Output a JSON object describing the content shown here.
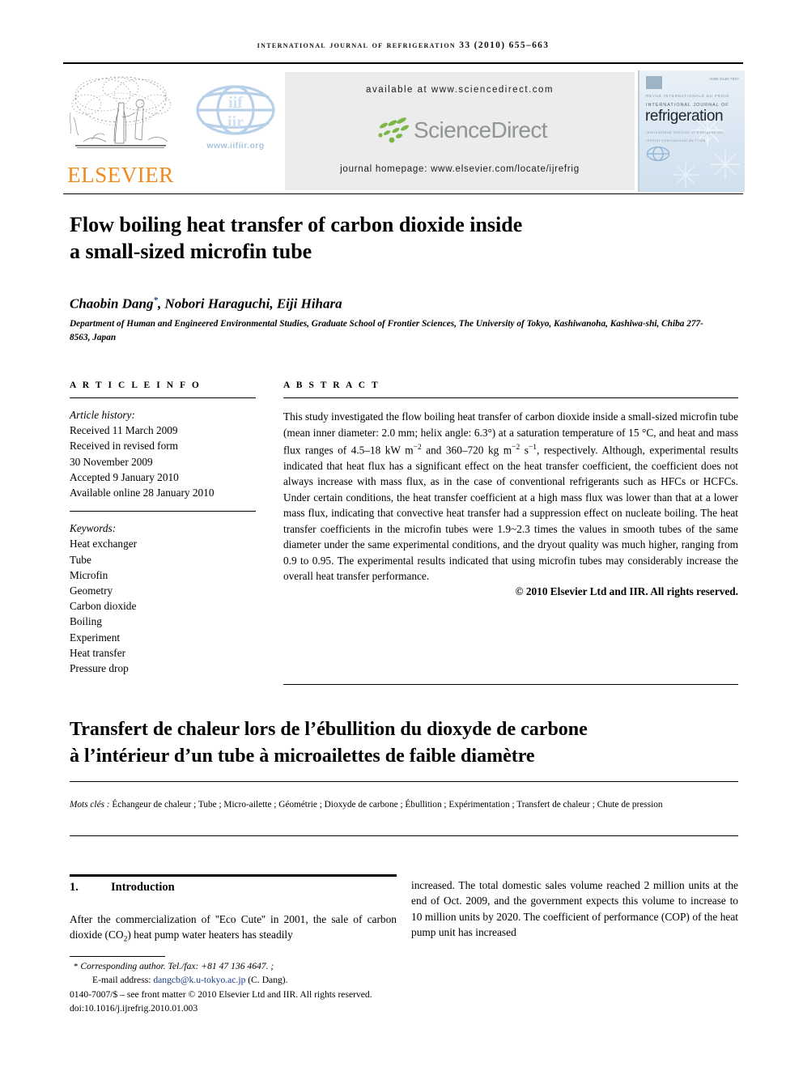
{
  "running_head": "International Journal of Refrigeration 33 (2010) 655–663",
  "masthead": {
    "elsevier_label": "ELSEVIER",
    "elsevier_tree_icon": "elsevier-tree-icon",
    "iir_url": "www.iifiir.org",
    "iir_logo_icon": "iir-globe-icon",
    "available_at": "available at www.sciencedirect.com",
    "sciencedirect_label": "ScienceDirect",
    "sciencedirect_icon": "sciencedirect-leaf-dots-icon",
    "journal_homepage": "journal homepage: www.elsevier.com/locate/ijrefrig",
    "cover": {
      "isbn_line": "ISSN 0140-7007",
      "line1": "REVUE INTERNATIONALE DU FROID",
      "line2": "INTERNATIONAL JOURNAL OF",
      "title": "refrigeration",
      "sub1": "International Institute of Refrigeration",
      "sub2": "Institut International du Froid",
      "iir_mark_icon": "iir-globe-icon"
    }
  },
  "article": {
    "title_line1": "Flow boiling heat transfer of carbon dioxide inside",
    "title_line2": "a small-sized microfin tube",
    "authors": "Chaobin Dang",
    "author_star": "*",
    "authors_rest": ", Nobori Haraguchi, Eiji Hihara",
    "affiliation": "Department of Human and Engineered Environmental Studies, Graduate School of Frontier Sciences, The University of Tokyo, Kashiwanoha, Kashiwa-shi, Chiba 277-8563, Japan"
  },
  "article_info": {
    "heading": "A R T I C L E  I N F O",
    "history_label": "Article history:",
    "history": [
      "Received 11 March 2009",
      "Received in revised form",
      "30 November 2009",
      "Accepted 9 January 2010",
      "Available online 28 January 2010"
    ],
    "keywords_label": "Keywords:",
    "keywords": [
      "Heat exchanger",
      "Tube",
      "Microfin",
      "Geometry",
      "Carbon dioxide",
      "Boiling",
      "Experiment",
      "Heat transfer",
      "Pressure drop"
    ]
  },
  "abstract": {
    "heading": "A B S T R A C T",
    "part1": "This study investigated the flow boiling heat transfer of carbon dioxide inside a small-sized microfin tube (mean inner diameter: 2.0 mm; helix angle: 6.3°) at a saturation temperature of 15 °C, and heat and mass flux ranges of 4.5–18 kW m",
    "sup1": "−2",
    "part2": " and 360–720 kg m",
    "sup2": "−2",
    "part3": " s",
    "sup3": "−1",
    "part4": ", respectively. Although, experimental results indicated that heat flux has a significant effect on the heat transfer coefficient, the coefficient does not always increase with mass flux, as in the case of conventional refrigerants such as HFCs or HCFCs. Under certain conditions, the heat transfer coefficient at a high mass flux was lower than that at a lower mass flux, indicating that convective heat transfer had a suppression effect on nucleate boiling. The heat transfer coefficients in the microfin tubes were 1.9~2.3 times the values in smooth tubes of the same diameter under the same experimental conditions, and the dryout quality was much higher, ranging from 0.9 to 0.95. The experimental results indicated that using microfin tubes may considerably increase the overall heat transfer performance.",
    "copyright": "© 2010 Elsevier Ltd and IIR. All rights reserved."
  },
  "french": {
    "title_line1": "Transfert de chaleur lors de l’ébullition du dioxyde de carbone",
    "title_line2": "à l’intérieur d’un tube à microailettes de faible diamètre",
    "keywords_label": "Mots clés :",
    "keywords_text": " Échangeur de chaleur ; Tube ; Micro-ailette ; Géométrie ; Dioxyde de carbone ; Ébullition ; Expérimentation ; Transfert de chaleur ; Chute de pression"
  },
  "body": {
    "section_number": "1.",
    "section_title": "Introduction",
    "col_left_part1": "After the commercialization of ''Eco Cute'' in 2001, the sale of carbon dioxide (CO",
    "col_left_sub": "2",
    "col_left_part2": ") heat pump water heaters has steadily",
    "col_right": "increased. The total domestic sales volume reached 2 million units at the end of Oct. 2009, and the government expects this volume to increase to 10 million units by 2020. The coefficient of performance (COP) of the heat pump unit has increased"
  },
  "footnote": {
    "star": "*",
    "corresponding": "Corresponding author. Tel./fax: +81 47 136 4647. ;",
    "email_label": "E-mail address:",
    "email": "dangcb@k.u-tokyo.ac.jp",
    "email_suffix": "(C. Dang).",
    "issn_line": "0140-7007/$ – see front matter © 2010 Elsevier Ltd and IIR. All rights reserved.",
    "doi_line": "doi:10.1016/j.ijrefrig.2010.01.003"
  },
  "colors": {
    "elsevier_orange": "#F08A1C",
    "sciencedirect_grey": "#8f9496",
    "sciencedirect_green": "#7AB648",
    "panel_grey": "#ececec",
    "link_blue": "#1a3b8b",
    "iir_blue": "#a9c4e0",
    "cover_blue": "#dfe9f2"
  }
}
